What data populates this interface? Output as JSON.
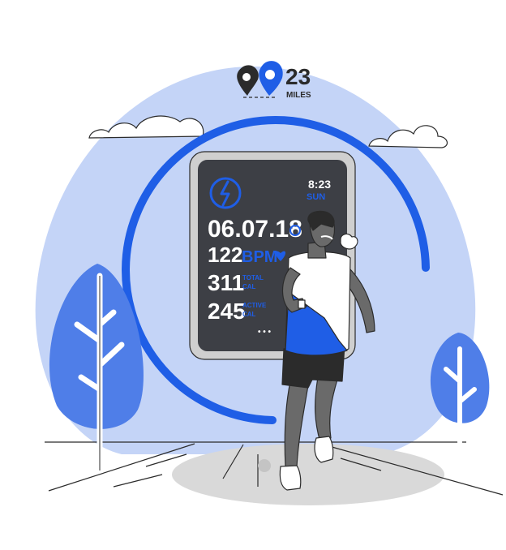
{
  "distance": {
    "value": "23",
    "unit": "MILES"
  },
  "watch": {
    "time": "8:23",
    "day": "SUN",
    "date": "06.07.18",
    "heart_rate": {
      "value": "122",
      "unit": "BPM"
    },
    "total_cal": {
      "value": "311",
      "label_line1": "TOTAL",
      "label_line2": "CAL"
    },
    "active_cal": {
      "value": "245",
      "label_line1": "ACTIVE",
      "label_line2": "CAL"
    },
    "more_indicator": "• • •"
  },
  "colors": {
    "accent": "#1f5ee6",
    "blob": "#c4d4f7",
    "tree": "#4f7ee8",
    "watch_face": "#3d3f45",
    "watch_frame": "#cfcfcf",
    "skin": "#6a6a6a",
    "shorts": "#2b2b2b",
    "ground": "#d9d9d9"
  },
  "icons": [
    "location-pin-icon",
    "running-person-icon",
    "heart-icon",
    "reload-icon"
  ]
}
